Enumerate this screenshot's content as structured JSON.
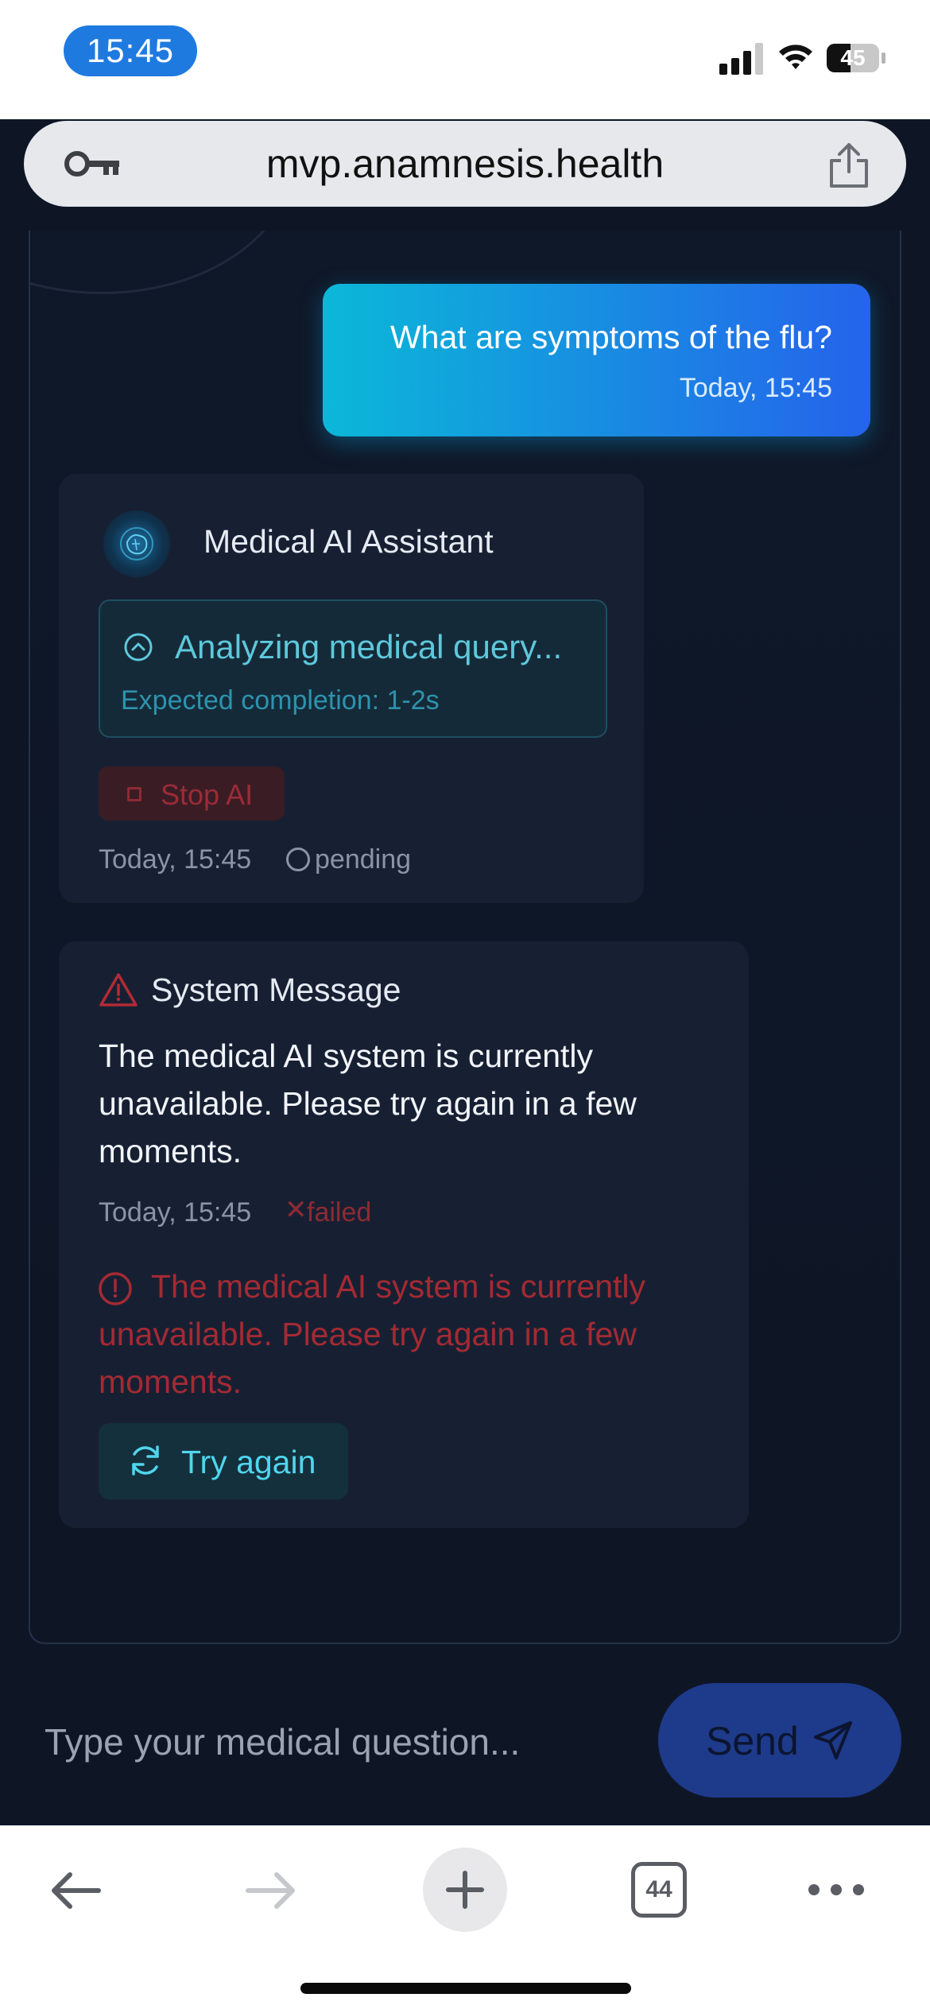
{
  "status_bar": {
    "time": "15:45",
    "battery_level": "45",
    "battery_fraction": 0.45,
    "time_pill_color": "#1f7ae0"
  },
  "url_bar": {
    "url": "mvp.anamnesis.health",
    "left_icon": "key-icon",
    "right_icon": "share-icon"
  },
  "chat": {
    "user_message": {
      "text": "What are symptoms of the flu?",
      "timestamp": "Today, 15:45"
    },
    "ai_message": {
      "sender": "Medical AI Assistant",
      "avatar_icon": "brain-avatar",
      "status_title": "Analyzing medical query...",
      "status_subtitle": "Expected completion: 1-2s",
      "stop_label": "Stop AI",
      "timestamp": "Today, 15:45",
      "state": "pending"
    },
    "system_message": {
      "title": "System Message",
      "body": "The medical AI system is currently unavailable. Please try again in a few moments.",
      "timestamp": "Today, 15:45",
      "state": "failed",
      "error_text": "The medical AI system is currently unavailable. Please try again in a few moments.",
      "retry_label": "Try again"
    }
  },
  "composer": {
    "placeholder": "Type your medical question...",
    "send_label": "Send"
  },
  "toolbar": {
    "tab_count": "44",
    "icons": [
      "back-arrow-icon",
      "forward-arrow-icon",
      "plus-icon",
      "tabs-icon",
      "more-icon"
    ]
  },
  "colors": {
    "accent_cyan": "#0bb8d8",
    "accent_blue": "#2563eb",
    "error_red": "#a42a33",
    "background": "#0e1626"
  }
}
